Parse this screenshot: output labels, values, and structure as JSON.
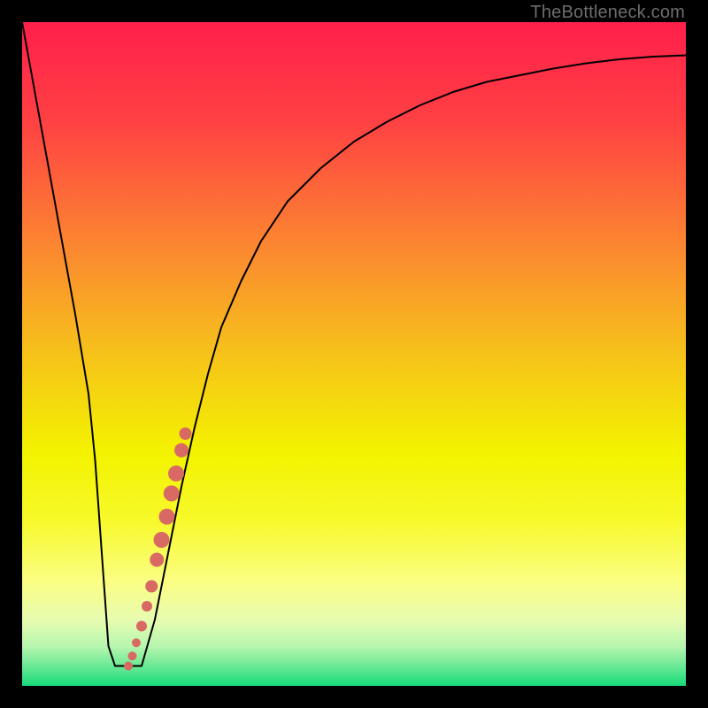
{
  "attribution": "TheBottleneck.com",
  "chart_data": {
    "type": "line",
    "title": "",
    "xlabel": "",
    "ylabel": "",
    "xlim": [
      0,
      100
    ],
    "ylim": [
      0,
      100
    ],
    "grid": false,
    "legend": false,
    "background_gradient": {
      "stops": [
        {
          "offset": 0.0,
          "color": "#ff1f4b"
        },
        {
          "offset": 0.15,
          "color": "#ff4143"
        },
        {
          "offset": 0.35,
          "color": "#fb8b2f"
        },
        {
          "offset": 0.5,
          "color": "#f6c21a"
        },
        {
          "offset": 0.65,
          "color": "#f3f300"
        },
        {
          "offset": 0.75,
          "color": "#f7f92a"
        },
        {
          "offset": 0.84,
          "color": "#fbfe80"
        },
        {
          "offset": 0.9,
          "color": "#e7fcb0"
        },
        {
          "offset": 0.94,
          "color": "#b8f6af"
        },
        {
          "offset": 0.97,
          "color": "#6be995"
        },
        {
          "offset": 1.0,
          "color": "#17da7b"
        }
      ]
    },
    "series": [
      {
        "name": "bottleneck-curve",
        "stroke": "#000000",
        "stroke_width": 2,
        "x": [
          0,
          2,
          4,
          6,
          8,
          10,
          11,
          12,
          13,
          14,
          16,
          18,
          20,
          22,
          24,
          26,
          28,
          30,
          33,
          36,
          40,
          45,
          50,
          55,
          60,
          65,
          70,
          75,
          80,
          85,
          90,
          95,
          100
        ],
        "y": [
          100,
          89,
          78,
          67,
          56,
          44,
          34,
          20,
          6,
          3,
          3,
          3,
          10,
          20,
          30,
          39,
          47,
          54,
          61,
          67,
          73,
          78,
          82,
          85,
          87.5,
          89.5,
          91,
          92,
          93,
          93.8,
          94.4,
          94.8,
          95
        ]
      }
    ],
    "points": {
      "name": "sample-points",
      "color": "#d96a63",
      "radius_min": 5,
      "radius_max": 9,
      "data": [
        {
          "x": 16.0,
          "y": 3.0,
          "r": 5
        },
        {
          "x": 16.6,
          "y": 4.5,
          "r": 5
        },
        {
          "x": 17.2,
          "y": 6.5,
          "r": 5
        },
        {
          "x": 18.0,
          "y": 9.0,
          "r": 6
        },
        {
          "x": 18.8,
          "y": 12.0,
          "r": 6
        },
        {
          "x": 19.5,
          "y": 15.0,
          "r": 7
        },
        {
          "x": 20.3,
          "y": 19.0,
          "r": 8
        },
        {
          "x": 21.0,
          "y": 22.0,
          "r": 9
        },
        {
          "x": 21.8,
          "y": 25.5,
          "r": 9
        },
        {
          "x": 22.5,
          "y": 29.0,
          "r": 9
        },
        {
          "x": 23.2,
          "y": 32.0,
          "r": 9
        },
        {
          "x": 24.0,
          "y": 35.5,
          "r": 8
        },
        {
          "x": 24.6,
          "y": 38.0,
          "r": 7
        }
      ]
    }
  }
}
